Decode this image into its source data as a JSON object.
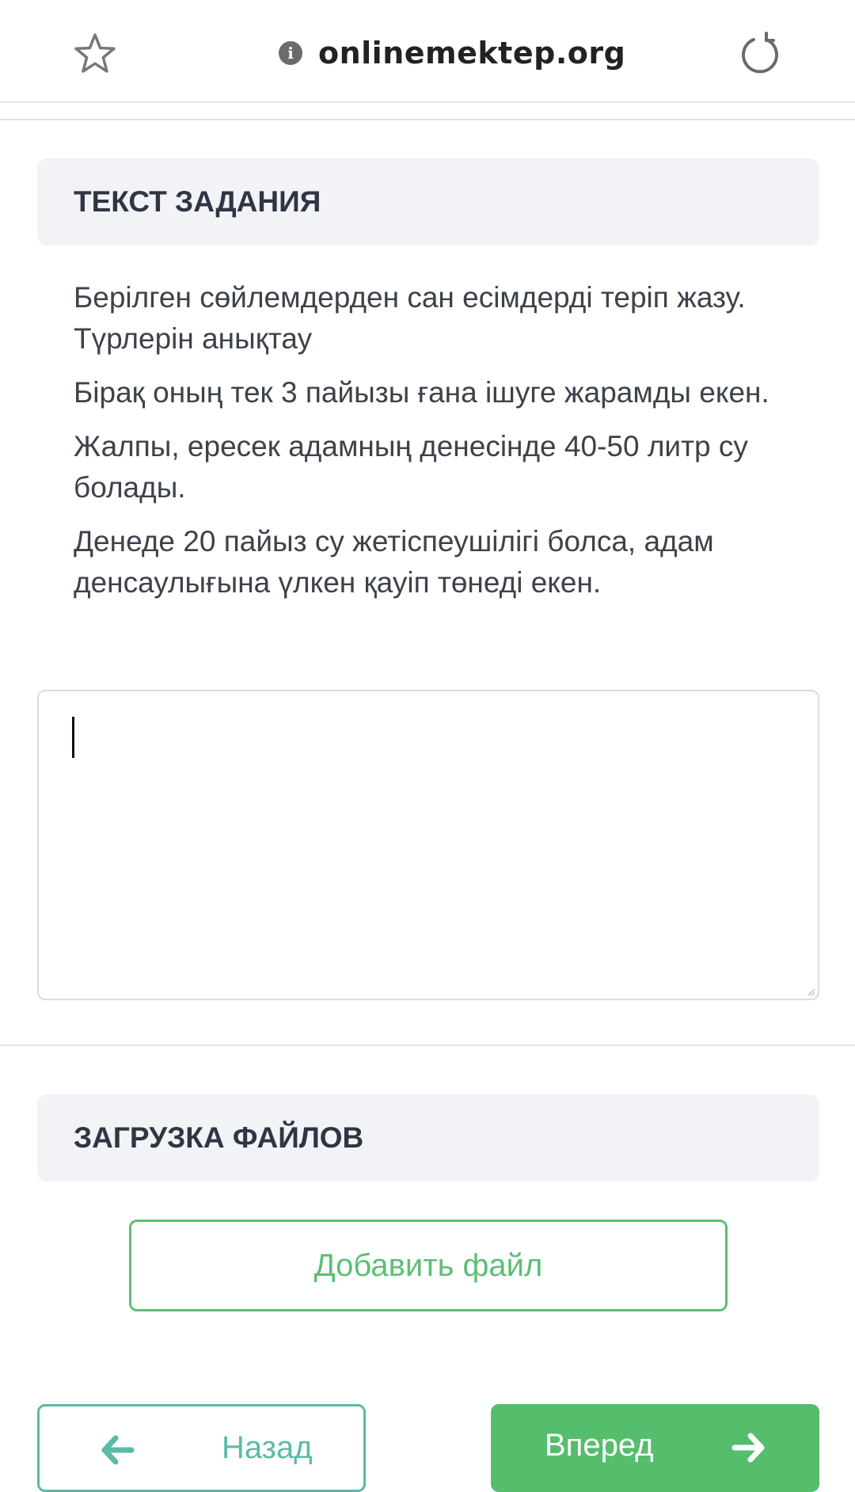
{
  "browser": {
    "domain": "onlinemektep.org",
    "info_icon_glyph": "i",
    "icons": [
      "star-icon",
      "info-icon",
      "reload-icon"
    ]
  },
  "task": {
    "header": "ТЕКСТ ЗАДАНИЯ",
    "paragraphs": [
      "Берілген сөйлемдерден сан есімдерді теріп жазу. Түрлерін анықтау",
      "Бірақ оның тек 3 пайызы ғана ішуге жарамды екен.",
      "Жалпы, ересек адамның денесінде 40-50 литр су болады.",
      "Денеде 20 пайыз су жетіспеушілігі болса, адам денсаулығына үлкен қауіп төнеді екен."
    ],
    "answer_value": ""
  },
  "upload": {
    "header": "ЗАГРУЗКА ФАЙЛОВ",
    "add_file_label": "Добавить файл"
  },
  "nav": {
    "back_label": "Назад",
    "back_icon": "arrow-left-icon",
    "forward_label": "Вперед",
    "forward_icon": "arrow-right-icon"
  },
  "colors": {
    "green": "#55bd6c",
    "teal": "#5bbaa8",
    "header_bg": "#f2f3f7",
    "text": "#3d424a"
  }
}
